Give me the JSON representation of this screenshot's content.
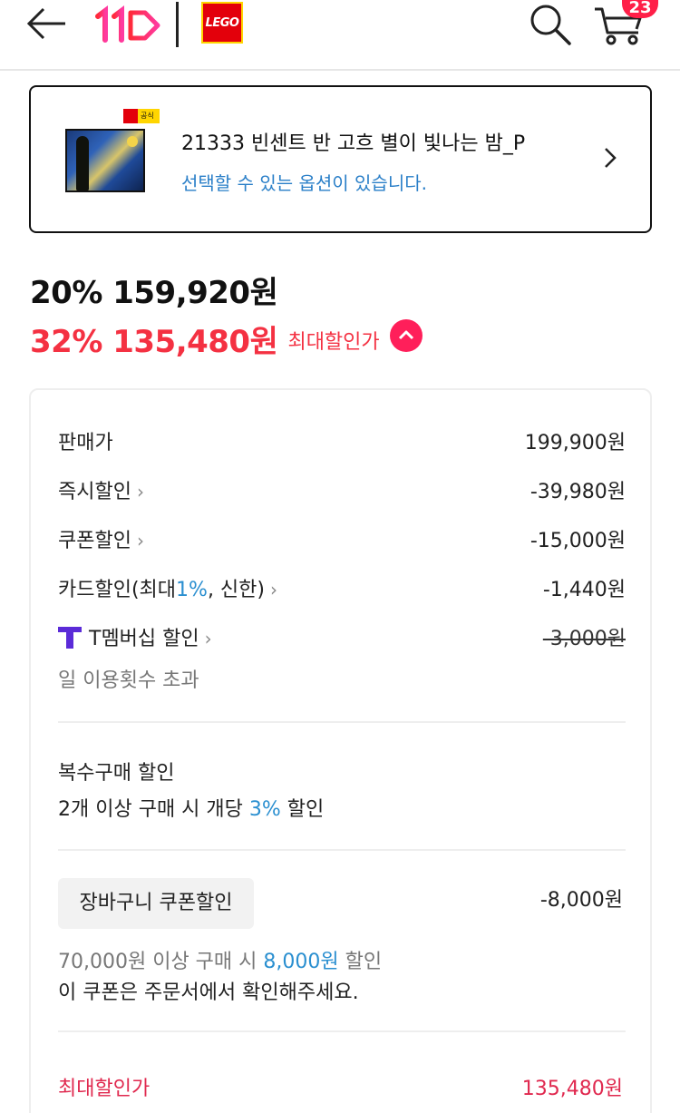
{
  "header": {
    "back_icon": "back-arrow-icon",
    "site_logo": "11번가",
    "brand_logo": "LEGO",
    "search_icon": "search-icon",
    "cart_icon": "cart-icon",
    "cart_count": "23",
    "accent": "#ff1f48"
  },
  "option_card": {
    "badge": "공식",
    "title": "21333 빈센트 반 고흐 별이 빛나는 밤_P",
    "subtitle": "선택할 수 있는 옵션이 있습니다.",
    "chevron_icon": "chevron-right-icon"
  },
  "prices": {
    "sale": "20% 159,920원",
    "max_discount": "32% 135,480원",
    "max_discount_label": "최대할인가",
    "toggle_icon": "chevron-up-icon",
    "accent": "#f43142"
  },
  "breakdown": {
    "rows": [
      {
        "label": "판매가",
        "amount": "199,900원"
      },
      {
        "label": "즉시할인",
        "chevron": "›",
        "amount": "-39,980원"
      },
      {
        "label": "쿠폰할인",
        "chevron": "›",
        "amount": "-15,000원"
      },
      {
        "label_pre": "카드할인(최대",
        "label_blue": "1%",
        "label_post": ", 신한)",
        "chevron": "›",
        "amount": "-1,440원"
      },
      {
        "label": "T멤버십 할인",
        "chevron": "›",
        "amount": "-3,000원",
        "icon": "t-membership-icon"
      }
    ],
    "tmember_note": "일 이용횟수 초과",
    "multi_title": "복수구매 할인",
    "multi_pre": "2개 이상 구매 시 개당 ",
    "multi_blue": "3%",
    "multi_post": " 할인",
    "cart_coupon_label": "장바구니 쿠폰할인",
    "cart_coupon_amount": "-8,000원",
    "cart_note_pre": "70,000원 이상 구매 시 ",
    "cart_note_blue": "8,000원",
    "cart_note_post": " 할인",
    "cart_note2": "이 쿠폰은 주문서에서 확인해주세요.",
    "final_label": "최대할인가",
    "final_amount": "135,480원"
  }
}
